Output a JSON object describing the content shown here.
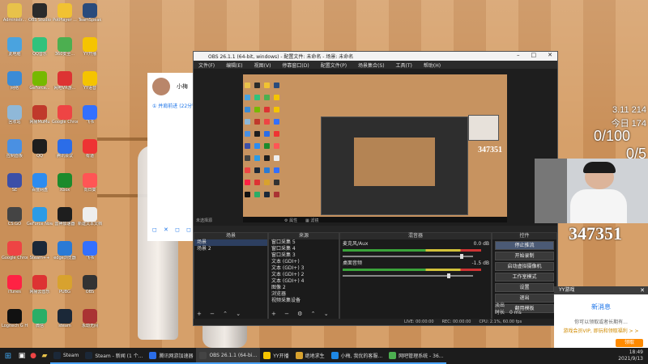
{
  "desktop": {
    "icons": [
      {
        "label": "Administr...",
        "color": "#e8c24a"
      },
      {
        "label": "OBS Studio",
        "color": "#2b2b2b"
      },
      {
        "label": "PotPlayer ...",
        "color": "#f1c232"
      },
      {
        "label": "TeamSpeak",
        "color": "#2a4b7c"
      },
      {
        "label": "此电脑",
        "color": "#4aa3df"
      },
      {
        "label": "QQ音乐",
        "color": "#31c27c"
      },
      {
        "label": "360安全...",
        "color": "#4caf50"
      },
      {
        "label": "YY开播",
        "color": "#f5c400"
      },
      {
        "label": "网络",
        "color": "#3b8bd6"
      },
      {
        "label": "GeForce...",
        "color": "#76b900"
      },
      {
        "label": "网吧VR游...",
        "color": "#d33"
      },
      {
        "label": "YY语音",
        "color": "#f5c400"
      },
      {
        "label": "回收站",
        "color": "#8fb8d8"
      },
      {
        "label": "网易MuMu",
        "color": "#c0392b"
      },
      {
        "label": "Google Chrome",
        "color": "#e44"
      },
      {
        "label": "飞书",
        "color": "#3370ff"
      },
      {
        "label": "控制面板",
        "color": "#4a90e2"
      },
      {
        "label": "QQ",
        "color": "#1e1e1e"
      },
      {
        "label": "腾讯会议",
        "color": "#2b6de8"
      },
      {
        "label": "有道",
        "color": "#e33"
      },
      {
        "label": "SE",
        "color": "#3b4fa8"
      },
      {
        "label": "百度网盘",
        "color": "#2d8cf0"
      },
      {
        "label": "Xbox",
        "color": "#1c8a2c"
      },
      {
        "label": "向日葵",
        "color": "#f55"
      },
      {
        "label": "CS:GO",
        "color": "#444"
      },
      {
        "label": "GeForce Now",
        "color": "#2c9be6"
      },
      {
        "label": "雷神加速器",
        "color": "#1e1e1e"
      },
      {
        "label": "新建文本文档",
        "color": "#eee"
      },
      {
        "label": "Google Chrome",
        "color": "#e44"
      },
      {
        "label": "Steam++",
        "color": "#1b2838"
      },
      {
        "label": "edge浏览器",
        "color": "#2a7ad5"
      },
      {
        "label": "飞书",
        "color": "#3370ff"
      },
      {
        "label": "iTunes",
        "color": "#f24"
      },
      {
        "label": "网易云音乐",
        "color": "#d33"
      },
      {
        "label": "PUBG",
        "color": "#d8a22e"
      },
      {
        "label": "OBS",
        "color": "#333"
      },
      {
        "label": "Logitech G HUB",
        "color": "#111"
      },
      {
        "label": "微信",
        "color": "#2aae67"
      },
      {
        "label": "steam",
        "color": "#1b2838"
      },
      {
        "label": "永劫无间",
        "color": "#a33"
      }
    ]
  },
  "chat": {
    "name": "小梅",
    "status": "① 并肩前进 (22分钟)",
    "controls": "◻ ✕ ◻ ◻"
  },
  "obs": {
    "title": "OBS 26.1.1 (64-bit, windows) - 配置文件: 未命名 - 场景: 未命名",
    "menu": [
      "文件(F)",
      "编辑(E)",
      "视图(V)",
      "停靠窗口(D)",
      "配置文件(P)",
      "场景集合(S)",
      "工具(T)",
      "帮助(H)"
    ],
    "no_source": "未选择源",
    "props": "⚙ 属性",
    "filters": "▦ 滤镜",
    "preview_number": "347351",
    "panels": {
      "scenes": {
        "header": "场景",
        "items": [
          "场景",
          "场景 2"
        ]
      },
      "sources": {
        "header": "来源",
        "items": [
          "窗口采集 5",
          "窗口采集 4",
          "窗口采集 3",
          "文本 (GDI+)",
          "文本 (GDI+) 3",
          "文本 (GDI+) 2",
          "文本 (GDI+) 4",
          "图像 2",
          "浏览器",
          "视频采集设备"
        ]
      },
      "mixer": {
        "header": "混音器",
        "tracks": [
          {
            "name": "麦克风/Aux",
            "db": "0.0 dB"
          },
          {
            "name": "桌面音频",
            "db": "-1.5 dB"
          }
        ]
      },
      "transitions": {
        "header": "转场",
        "mode_label": "淡出",
        "duration_label": "时长",
        "duration_value": "0 ms"
      },
      "controls": {
        "header": "控件",
        "buttons": [
          "停止推流",
          "开始录制",
          "启动虚拟摄像机",
          "工作室模式",
          "设置",
          "退出",
          "翻用模板"
        ]
      }
    },
    "status": [
      "LIVE: 00:00:00",
      "REC: 00:00:00",
      "CPU: 2.1%, 60.00 fps"
    ]
  },
  "overlay": {
    "stat1": "3.11 214",
    "stat2": "今日 174",
    "count1": "0/100",
    "count2": "0/5",
    "big_number": "347351"
  },
  "popup": {
    "title": "YY游戏",
    "close": "✕",
    "heading": "新消息",
    "line1": "你可以领取或者长期有...",
    "line2": "游戏会员VIP, 即玩和领取福利 > >",
    "button": "领取"
  },
  "taskbar": {
    "apps": [
      {
        "label": "Steam",
        "color": "#1b2838",
        "active": false
      },
      {
        "label": "Steam - 新闻 (1 个...",
        "color": "#1b2838",
        "active": false
      },
      {
        "label": "腾讯网游加速器",
        "color": "#2b6de8",
        "active": false
      },
      {
        "label": "OBS 26.1.1 (64-bi...",
        "color": "#444",
        "active": true
      },
      {
        "label": "YY开播",
        "color": "#f5c400",
        "active": false
      },
      {
        "label": "绝地求生",
        "color": "#d8a22e",
        "active": false
      },
      {
        "label": "小梅, 我优的客服...",
        "color": "#1e88e5",
        "active": false
      },
      {
        "label": "网吧管理系统 - 36...",
        "color": "#4caf50",
        "active": false
      }
    ],
    "time": "18:49",
    "date": "2021/9/13"
  }
}
